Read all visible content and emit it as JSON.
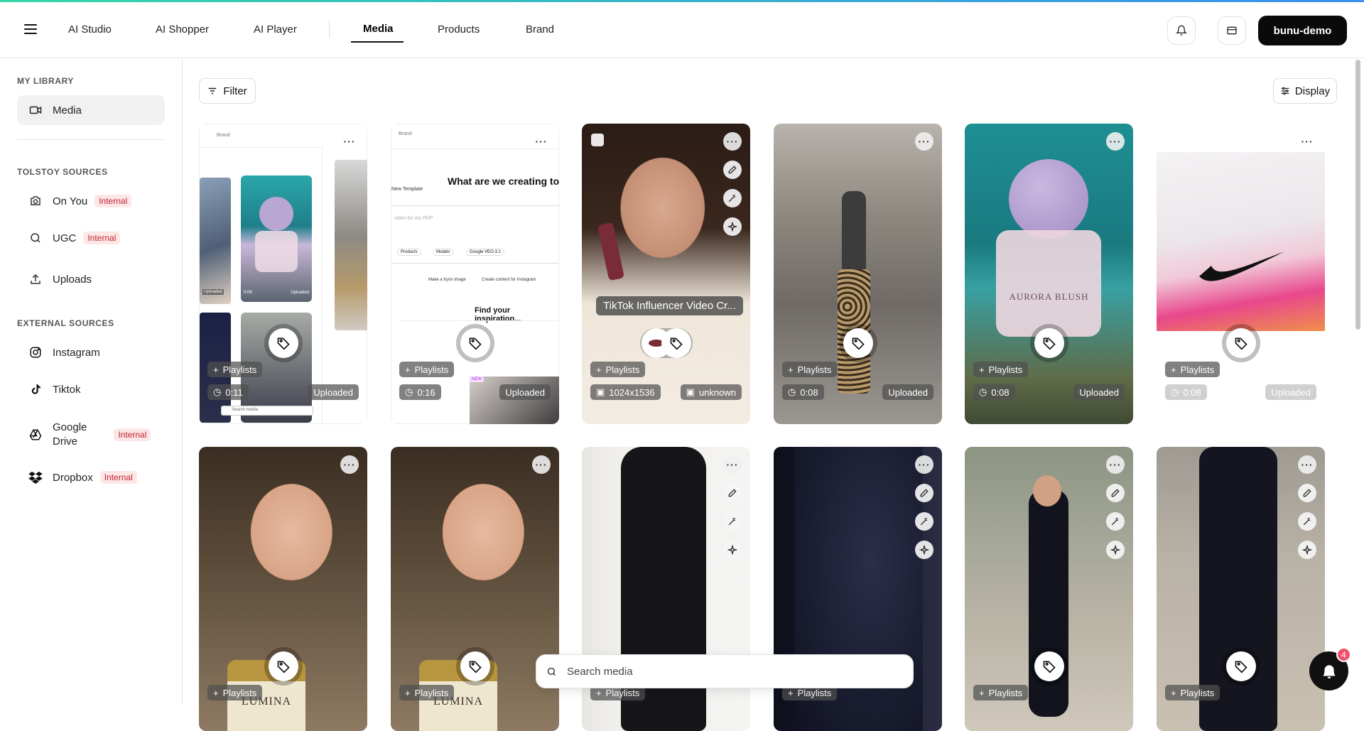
{
  "header": {
    "nav": [
      {
        "label": "AI Studio",
        "active": false
      },
      {
        "label": "AI Shopper",
        "active": false
      },
      {
        "label": "AI Player",
        "active": false
      },
      {
        "label": "Media",
        "active": true
      },
      {
        "label": "Products",
        "active": false
      },
      {
        "label": "Brand",
        "active": false
      }
    ],
    "user_label": "bunu-demo"
  },
  "sidebar": {
    "my_library_title": "MY LIBRARY",
    "media_label": "Media",
    "tolstoy_title": "TOLSTOY SOURCES",
    "on_you_label": "On You",
    "ugc_label": "UGC",
    "uploads_label": "Uploads",
    "external_title": "EXTERNAL SOURCES",
    "instagram_label": "Instagram",
    "tiktok_label": "Tiktok",
    "gdrive_label_1": "Google",
    "gdrive_label_2": "Drive",
    "dropbox_label": "Dropbox",
    "internal_badge": "Internal"
  },
  "toolbar": {
    "filter_label": "Filter",
    "display_label": "Display"
  },
  "cards_row1": [
    {
      "duration": "0:11",
      "source": "Uploaded",
      "playlist": "Playlists"
    },
    {
      "duration": "0:16",
      "source": "Uploaded",
      "playlist": "Playlists",
      "template_brand": "Brand",
      "template_heading": "What are we creating to",
      "template_label": "New Template",
      "template_prompt": "video for my PDP",
      "chip_products": "Products",
      "chip_models": "Models",
      "chip_model": "Google VEO-3.1",
      "chip_tryon": "Make a tryon image",
      "chip_instagram": "Create content for Instagram",
      "inspiration": "Find your inspiration...",
      "new_badge": "NEW"
    },
    {
      "caption": "TikTok Influencer Video Cr...",
      "dimensions": "1024x1536",
      "source": "unknown",
      "playlist": "Playlists"
    },
    {
      "duration": "0:08",
      "source": "Uploaded",
      "playlist": "Playlists"
    },
    {
      "duration": "0:08",
      "source": "Uploaded",
      "playlist": "Playlists",
      "product_name": "AURORA BLUSH"
    },
    {
      "duration": "0:08",
      "source": "Uploaded",
      "playlist": "Playlists"
    }
  ],
  "card1_brand": "Brand",
  "card1_sub_labels": [
    "Uploaded",
    "0:08",
    "Uploaded",
    "Search media"
  ],
  "cards_row2": [
    {
      "playlist": "Playlists",
      "product_name": "LUMINA"
    },
    {
      "playlist": "Playlists",
      "product_name": "LUMINA"
    },
    {
      "playlist": "Playlists"
    },
    {
      "playlist": "Playlists"
    },
    {
      "playlist": "Playlists"
    },
    {
      "playlist": "Playlists"
    }
  ],
  "search": {
    "placeholder": "Search media"
  },
  "chat": {
    "badge_count": "4"
  },
  "colors": {
    "accent_dark": "#0a0a0a",
    "badge_bg": "#fde6e6",
    "badge_text": "#c0262f",
    "chat_badge": "#f0506e"
  }
}
